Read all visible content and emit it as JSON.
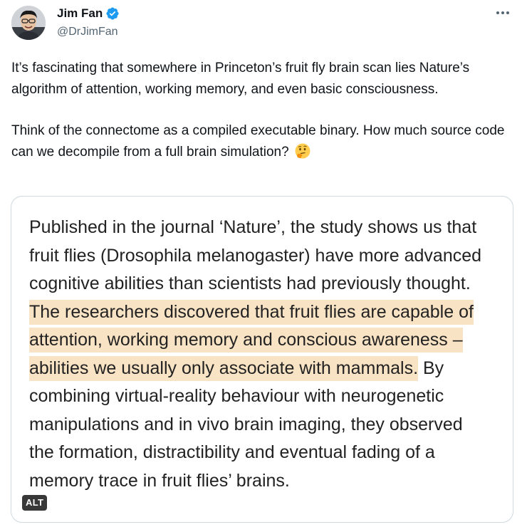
{
  "author": {
    "display_name": "Jim Fan",
    "handle": "@DrJimFan",
    "verified_color": "#1d9bf0"
  },
  "tweet": {
    "paragraph_1": "It’s fascinating that somewhere in Princeton’s fruit fly brain scan lies Nature’s algorithm of attention, working memory, and even basic consciousness.",
    "paragraph_2": "Think of the connectome as a compiled executable binary. How much source code can we decompile from a full brain simulation?",
    "emoji": "thinking-face"
  },
  "media": {
    "text_before": "Published in the journal ‘Nature’, the study shows us that fruit flies (Drosophila melanogaster) have more advanced cognitive abilities than scientists had previously thought. ",
    "text_highlighted": "The researchers discovered that fruit flies are capable of attention, working memory and conscious awareness – abilities we usually only associate with mammals.",
    "text_after": " By combining virtual-reality behaviour with neurogenetic manipulations and in vivo brain imaging, they observed the formation, distractibility and eventual fading of a memory trace in fruit flies’ brains.",
    "highlight_color": "#f9e3c5",
    "alt_label": "ALT"
  },
  "icons": {
    "more": "more-horizontal-icon",
    "verified": "verified-badge-icon"
  }
}
